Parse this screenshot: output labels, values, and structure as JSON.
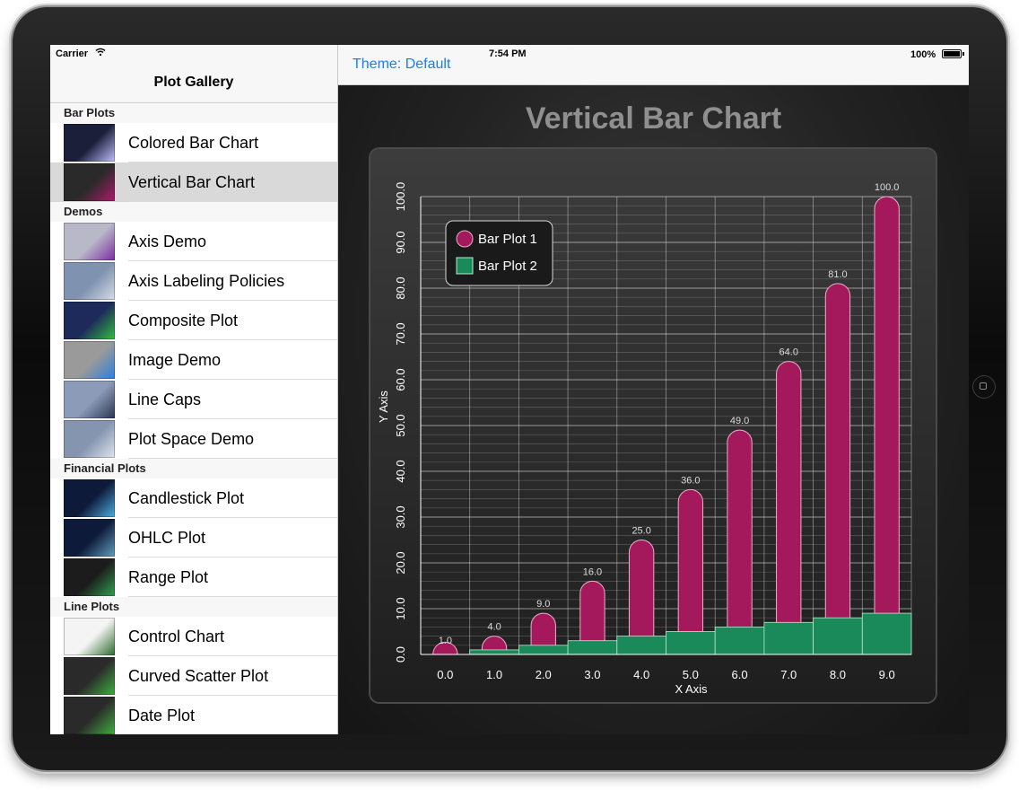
{
  "status_bar": {
    "carrier": "Carrier",
    "time": "7:54 PM",
    "battery": "100%"
  },
  "sidebar": {
    "title": "Plot Gallery",
    "sections": [
      {
        "header": "Bar Plots",
        "items": [
          {
            "label": "Colored Bar Chart",
            "thumb": "colored-bar-thumb"
          },
          {
            "label": "Vertical Bar Chart",
            "thumb": "vertical-bar-thumb",
            "selected": true
          }
        ]
      },
      {
        "header": "Demos",
        "items": [
          {
            "label": "Axis Demo",
            "thumb": "axis-demo-thumb"
          },
          {
            "label": "Axis Labeling Policies",
            "thumb": "axis-labeling-thumb"
          },
          {
            "label": "Composite Plot",
            "thumb": "composite-thumb"
          },
          {
            "label": "Image Demo",
            "thumb": "image-demo-thumb"
          },
          {
            "label": "Line Caps",
            "thumb": "line-caps-thumb"
          },
          {
            "label": "Plot Space Demo",
            "thumb": "plot-space-thumb"
          }
        ]
      },
      {
        "header": "Financial Plots",
        "items": [
          {
            "label": "Candlestick Plot",
            "thumb": "candlestick-thumb"
          },
          {
            "label": "OHLC Plot",
            "thumb": "ohlc-thumb"
          },
          {
            "label": "Range Plot",
            "thumb": "range-thumb"
          }
        ]
      },
      {
        "header": "Line Plots",
        "items": [
          {
            "label": "Control Chart",
            "thumb": "control-thumb"
          },
          {
            "label": "Curved Scatter Plot",
            "thumb": "curved-scatter-thumb"
          },
          {
            "label": "Date Plot",
            "thumb": "date-thumb"
          }
        ]
      }
    ]
  },
  "toolbar": {
    "theme_label": "Theme: Default"
  },
  "colors": {
    "bar_plot_1": "#a3195b",
    "bar_plot_2": "#1a8a5a",
    "link": "#1a7fe8"
  },
  "chart_data": {
    "type": "bar",
    "title": "Vertical Bar Chart",
    "xlabel": "X Axis",
    "ylabel": "Y Axis",
    "ylim": [
      0,
      100
    ],
    "x_ticks": [
      "0.0",
      "1.0",
      "2.0",
      "3.0",
      "4.0",
      "5.0",
      "6.0",
      "7.0",
      "8.0",
      "9.0"
    ],
    "y_ticks": [
      "0.0",
      "10.0",
      "20.0",
      "30.0",
      "40.0",
      "50.0",
      "60.0",
      "70.0",
      "80.0",
      "90.0",
      "100.0"
    ],
    "grid": true,
    "legend_position": "top-left",
    "series": [
      {
        "name": "Bar Plot 1",
        "x": [
          0,
          1,
          2,
          3,
          4,
          5,
          6,
          7,
          8,
          9
        ],
        "values": [
          1,
          4,
          9,
          16,
          25,
          36,
          49,
          64,
          81,
          100
        ],
        "value_labels": [
          "1.0",
          "4.0",
          "9.0",
          "16.0",
          "25.0",
          "36.0",
          "49.0",
          "64.0",
          "81.0",
          "100.0"
        ]
      },
      {
        "name": "Bar Plot 2",
        "x": [
          0,
          1,
          2,
          3,
          4,
          5,
          6,
          7,
          8,
          9
        ],
        "values": [
          0,
          1,
          2,
          3,
          4,
          5,
          6,
          7,
          8,
          9
        ]
      }
    ]
  }
}
